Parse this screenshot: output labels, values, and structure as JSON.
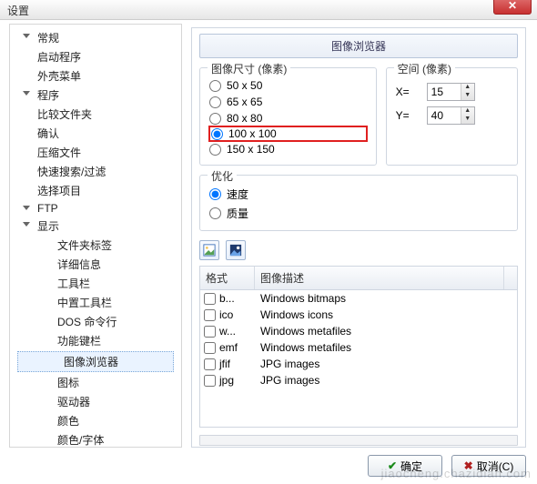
{
  "window": {
    "title": "设置",
    "close_glyph": "✕"
  },
  "sidebar": {
    "items": [
      {
        "label": "常规",
        "children": false,
        "arrow": true
      },
      {
        "label": "启动程序"
      },
      {
        "label": "外壳菜单"
      },
      {
        "label": "程序",
        "arrow": true
      },
      {
        "label": "比较文件夹"
      },
      {
        "label": "确认"
      },
      {
        "label": "压缩文件"
      },
      {
        "label": "快速搜索/过滤"
      },
      {
        "label": "选择项目"
      },
      {
        "label": "FTP",
        "arrow": true
      },
      {
        "label": "显示",
        "arrow": true,
        "expanded": true,
        "children": true
      }
    ],
    "display_children": [
      {
        "label": "文件夹标签"
      },
      {
        "label": "详细信息"
      },
      {
        "label": "工具栏"
      },
      {
        "label": "中置工具栏"
      },
      {
        "label": "DOS 命令行"
      },
      {
        "label": "功能键栏"
      },
      {
        "label": "图像浏览器",
        "selected": true
      },
      {
        "label": "图标"
      },
      {
        "label": "驱动器"
      },
      {
        "label": "颜色"
      },
      {
        "label": "颜色/字体"
      }
    ]
  },
  "panel": {
    "header": "图像浏览器",
    "image_size": {
      "legend": "图像尺寸 (像素)",
      "options": [
        "50 x 50",
        "65 x 65",
        "80 x 80",
        "100 x 100",
        "150 x 150"
      ],
      "selected_index": 3
    },
    "space": {
      "legend": "空间 (像素)",
      "x_label": "X=",
      "y_label": "Y=",
      "x_value": "15",
      "y_value": "40"
    },
    "optimize": {
      "legend": "优化",
      "options": [
        "速度",
        "质量"
      ],
      "selected_index": 0
    },
    "table": {
      "col1": "格式",
      "col2": "图像描述",
      "rows": [
        {
          "fmt": "b...",
          "desc": "Windows bitmaps"
        },
        {
          "fmt": "ico",
          "desc": "Windows icons"
        },
        {
          "fmt": "w...",
          "desc": "Windows metafiles"
        },
        {
          "fmt": "emf",
          "desc": "Windows metafiles"
        },
        {
          "fmt": "jfif",
          "desc": "JPG images"
        },
        {
          "fmt": "jpg",
          "desc": "JPG images"
        }
      ]
    },
    "buttons": {
      "ok": "确定",
      "cancel": "取消(C)"
    }
  },
  "watermark": "jiaocheng.chazidian.com"
}
